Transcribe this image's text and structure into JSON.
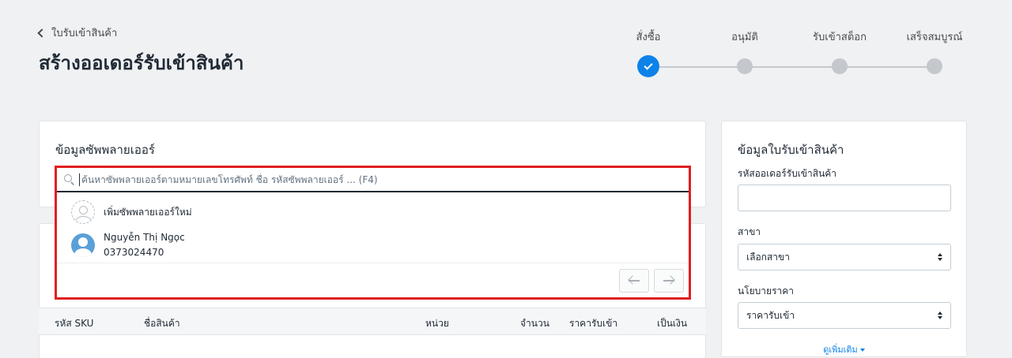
{
  "header": {
    "back_label": "ใบรับเข้าสินค้า",
    "title": "สร้างออเดอร์รับเข้าสินค้า"
  },
  "stepper": {
    "steps": [
      {
        "label": "สั่งซื้อ",
        "state": "done"
      },
      {
        "label": "อนุมัติ",
        "state": "pending"
      },
      {
        "label": "รับเข้าสต็อก",
        "state": "pending"
      },
      {
        "label": "เสร็จสมบูรณ์",
        "state": "pending"
      }
    ],
    "active_color": "#0d82e8"
  },
  "supplier_card": {
    "title": "ข้อมูลซัพพลายเออร์",
    "search_placeholder": "ค้นหาซัพพลายเออร์ตามหมายเลขโทรศัพท์ ชื่อ รหัสซัพพลายเออร์ ... (F4)",
    "search_value": ""
  },
  "dropdown": {
    "add_new_label": "เพิ่มซัพพลายเออร์ใหม่",
    "options": [
      {
        "name": "Nguyễn Thị Ngọc",
        "phone": "0373024470"
      }
    ],
    "highlight_color": "#e01f1f"
  },
  "table": {
    "columns": [
      "รหัส SKU",
      "ชื่อสินค้า",
      "หน่วย",
      "จำนวน",
      "ราคารับเข้า",
      "เป็นเงิน"
    ]
  },
  "side_card": {
    "title": "ข้อมูลใบรับเข้าสินค้า",
    "order_code_label": "รหัสออเดอร์รับเข้าสินค้า",
    "order_code_value": "",
    "branch_label": "สาขา",
    "branch_value": "เลือกสาขา",
    "price_policy_label": "นโยบายราคา",
    "price_policy_value": "ราคารับเข้า",
    "see_more": "ดูเพิ่มเติม"
  }
}
